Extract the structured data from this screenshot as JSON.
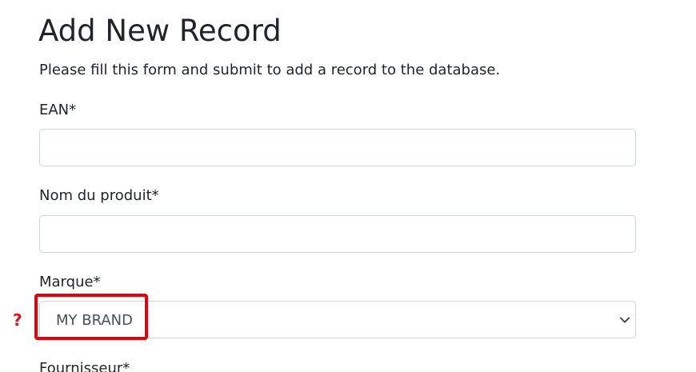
{
  "form": {
    "title": "Add New Record",
    "description": "Please fill this form and submit to add a record to the database.",
    "fields": {
      "ean": {
        "label": "EAN*",
        "value": ""
      },
      "product_name": {
        "label": "Nom du produit*",
        "value": ""
      },
      "brand": {
        "label": "Marque*",
        "selected": "MY BRAND"
      },
      "supplier": {
        "label": "Fournisseur*"
      }
    }
  },
  "annotation": {
    "marker": "?",
    "icon": "question-mark-icon",
    "highlight_color": "#e3000f"
  }
}
